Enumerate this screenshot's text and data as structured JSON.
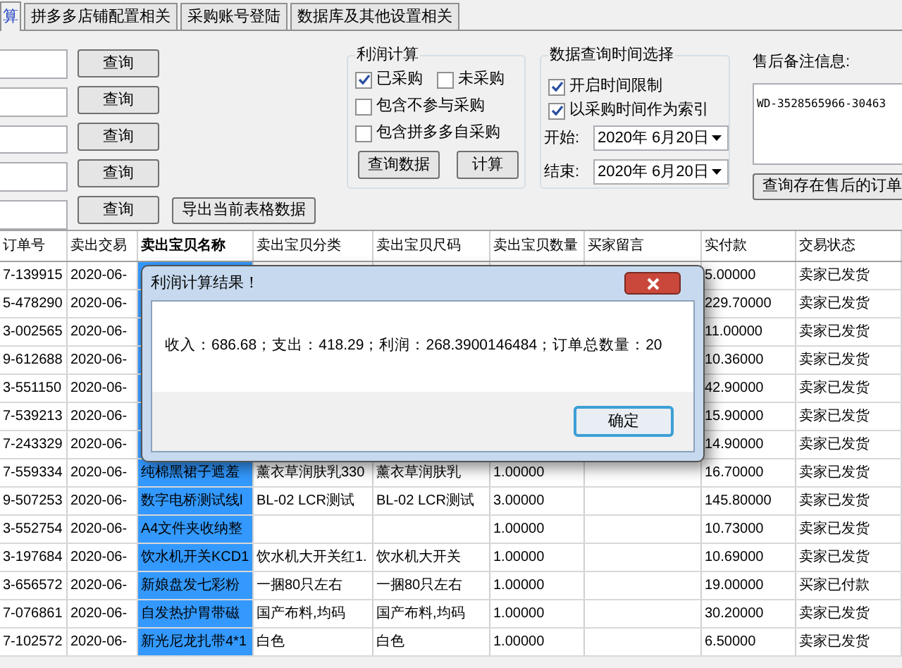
{
  "tabs": [
    {
      "label": "算",
      "selected": true
    },
    {
      "label": "拼多多店铺配置相关",
      "selected": false
    },
    {
      "label": "采购账号登陆",
      "selected": false
    },
    {
      "label": "数据库及其他设置相关",
      "selected": false
    }
  ],
  "query_rows": [
    {
      "button": "查询"
    },
    {
      "button": "查询"
    },
    {
      "button": "查询"
    },
    {
      "button": "查询"
    },
    {
      "button": "查询"
    }
  ],
  "export_button": "导出当前表格数据",
  "profit_calc": {
    "title": "利润计算",
    "options": [
      {
        "label": "已采购",
        "checked": true
      },
      {
        "label": "未采购",
        "checked": false
      },
      {
        "label": "包含不参与采购",
        "checked": false
      },
      {
        "label": "包含拼多多自采购",
        "checked": false
      }
    ],
    "buttons": [
      "查询数据",
      "计算"
    ]
  },
  "time_filter": {
    "title": "数据查询时间选择",
    "options": [
      {
        "label": "开启时间限制",
        "checked": true
      },
      {
        "label": "以采购时间作为索引",
        "checked": true
      }
    ],
    "start": {
      "label": "开始:",
      "value": "2020年  6月20日"
    },
    "end": {
      "label": "结束:",
      "value": "2020年  6月20日"
    }
  },
  "after_sale": {
    "label": "售后备注信息:",
    "value": "WD-3528565966-30463",
    "button": "查询存在售后的订单"
  },
  "table": {
    "columns": [
      "订单号",
      "卖出交易",
      "卖出宝贝名称",
      "卖出宝贝分类",
      "卖出宝贝尺码",
      "卖出宝贝数量",
      "买家留言",
      "实付款",
      "交易状态"
    ],
    "rows": [
      {
        "order": "7-139915",
        "time": "2020-06-",
        "paid": "5.00000",
        "status": "卖家已发货",
        "selected": true
      },
      {
        "order": "5-478290",
        "time": "2020-06-",
        "paid": "229.70000",
        "status": "卖家已发货",
        "selected": true
      },
      {
        "order": "3-002565",
        "time": "2020-06-",
        "paid": "11.00000",
        "status": "卖家已发货",
        "selected": true
      },
      {
        "order": "9-612688",
        "time": "2020-06-",
        "paid": "10.36000",
        "status": "卖家已发货",
        "selected": true
      },
      {
        "order": "3-551150",
        "time": "2020-06-",
        "paid": "42.90000",
        "status": "卖家已发货",
        "selected": true
      },
      {
        "order": "7-539213",
        "time": "2020-06-",
        "paid": "15.90000",
        "status": "卖家已发货",
        "selected": true
      },
      {
        "order": "7-243329",
        "time": "2020-06-",
        "paid": "14.90000",
        "status": "卖家已发货",
        "selected": true
      },
      {
        "order": "7-559334",
        "time": "2020-06-",
        "name": "纯棉黑裙子遮羞",
        "category": "薰衣草润肤乳330",
        "size": "薰衣草润肤乳",
        "qty": "1.00000",
        "paid": "16.70000",
        "status": "卖家已发货",
        "selected": true
      },
      {
        "order": "9-507253",
        "time": "2020-06-",
        "name": "数字电桥测试线l",
        "category": "BL-02 LCR测试",
        "size": "BL-02 LCR测试",
        "qty": "3.00000",
        "paid": "145.80000",
        "status": "卖家已发货",
        "selected": true
      },
      {
        "order": "3-552754",
        "time": "2020-06-",
        "name": "A4文件夹收纳整",
        "qty": "1.00000",
        "paid": "10.73000",
        "status": "卖家已发货",
        "selected": true
      },
      {
        "order": "3-197684",
        "time": "2020-06-",
        "name": "饮水机开关KCD1",
        "category": "饮水机大开关红1.",
        "size": "饮水机大开关",
        "qty": "1.00000",
        "paid": "10.69000",
        "status": "卖家已发货",
        "selected": true
      },
      {
        "order": "3-656572",
        "time": "2020-06-",
        "name": "新娘盘发七彩粉",
        "category": "一捆80只左右",
        "size": "一捆80只左右",
        "qty": "1.00000",
        "paid": "19.00000",
        "status": "买家已付款",
        "selected": true
      },
      {
        "order": "7-076861",
        "time": "2020-06-",
        "name": "自发热护胃带磁",
        "category": "国产布料,均码",
        "size": "国产布料,均码",
        "qty": "1.00000",
        "paid": "30.20000",
        "status": "卖家已发货",
        "selected": true
      },
      {
        "order": "7-102572",
        "time": "2020-06-",
        "name": "新光尼龙扎带4*1",
        "category": "白色",
        "size": "白色",
        "qty": "1.00000",
        "paid": "6.50000",
        "status": "卖家已发货",
        "selected": true
      }
    ]
  },
  "dialog": {
    "title": "利润计算结果！",
    "message": "收入：686.68；支出：418.29；利润：268.3900146484；订单总数量：20",
    "ok": "确定"
  }
}
